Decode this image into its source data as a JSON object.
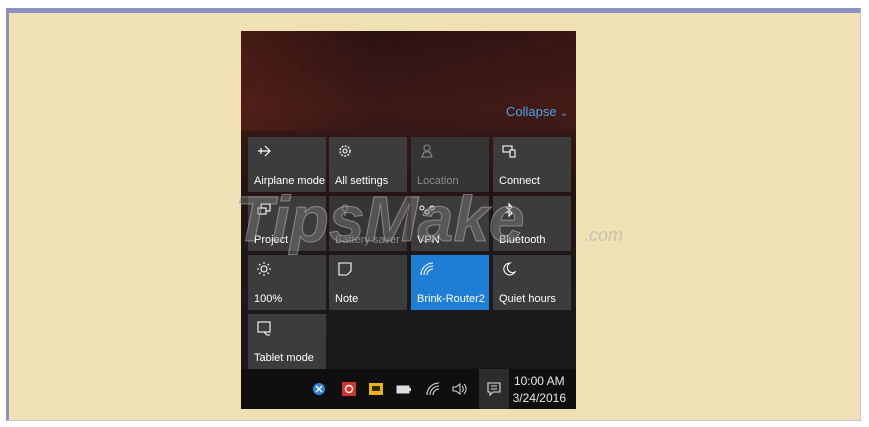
{
  "watermark": {
    "text": "TipsMake",
    "suffix": ".com"
  },
  "action_center": {
    "collapse_label": "Collapse",
    "tiles": [
      {
        "label": "Airplane mode",
        "icon": "airplane-icon",
        "state": "off"
      },
      {
        "label": "All settings",
        "icon": "gear-icon",
        "state": "off"
      },
      {
        "label": "Location",
        "icon": "location-icon",
        "state": "disabled"
      },
      {
        "label": "Connect",
        "icon": "connect-icon",
        "state": "off"
      },
      {
        "label": "Project",
        "icon": "project-icon",
        "state": "off"
      },
      {
        "label": "Battery saver",
        "icon": "battery-saver-icon",
        "state": "disabled"
      },
      {
        "label": "VPN",
        "icon": "vpn-icon",
        "state": "off"
      },
      {
        "label": "Bluetooth",
        "icon": "bluetooth-icon",
        "state": "off"
      },
      {
        "label": "100%",
        "icon": "brightness-icon",
        "state": "off"
      },
      {
        "label": "Note",
        "icon": "note-icon",
        "state": "off"
      },
      {
        "label": "Brink-Router2",
        "icon": "wifi-icon",
        "state": "on"
      },
      {
        "label": "Quiet hours",
        "icon": "moon-icon",
        "state": "off"
      },
      {
        "label": "Tablet mode",
        "icon": "tablet-mode-icon",
        "state": "off"
      }
    ]
  },
  "taskbar": {
    "time": "10:00 AM",
    "date": "3/24/2016",
    "tray_icons": [
      "network-globe-icon",
      "presentation-app-icon",
      "sticky-app-icon",
      "battery-icon",
      "wifi-icon",
      "volume-icon",
      "action-center-icon"
    ]
  },
  "colors": {
    "accent": "#1e7dd4",
    "frame": "#efe1b3",
    "border": "#8d8fc6",
    "link": "#4aa3ea"
  }
}
